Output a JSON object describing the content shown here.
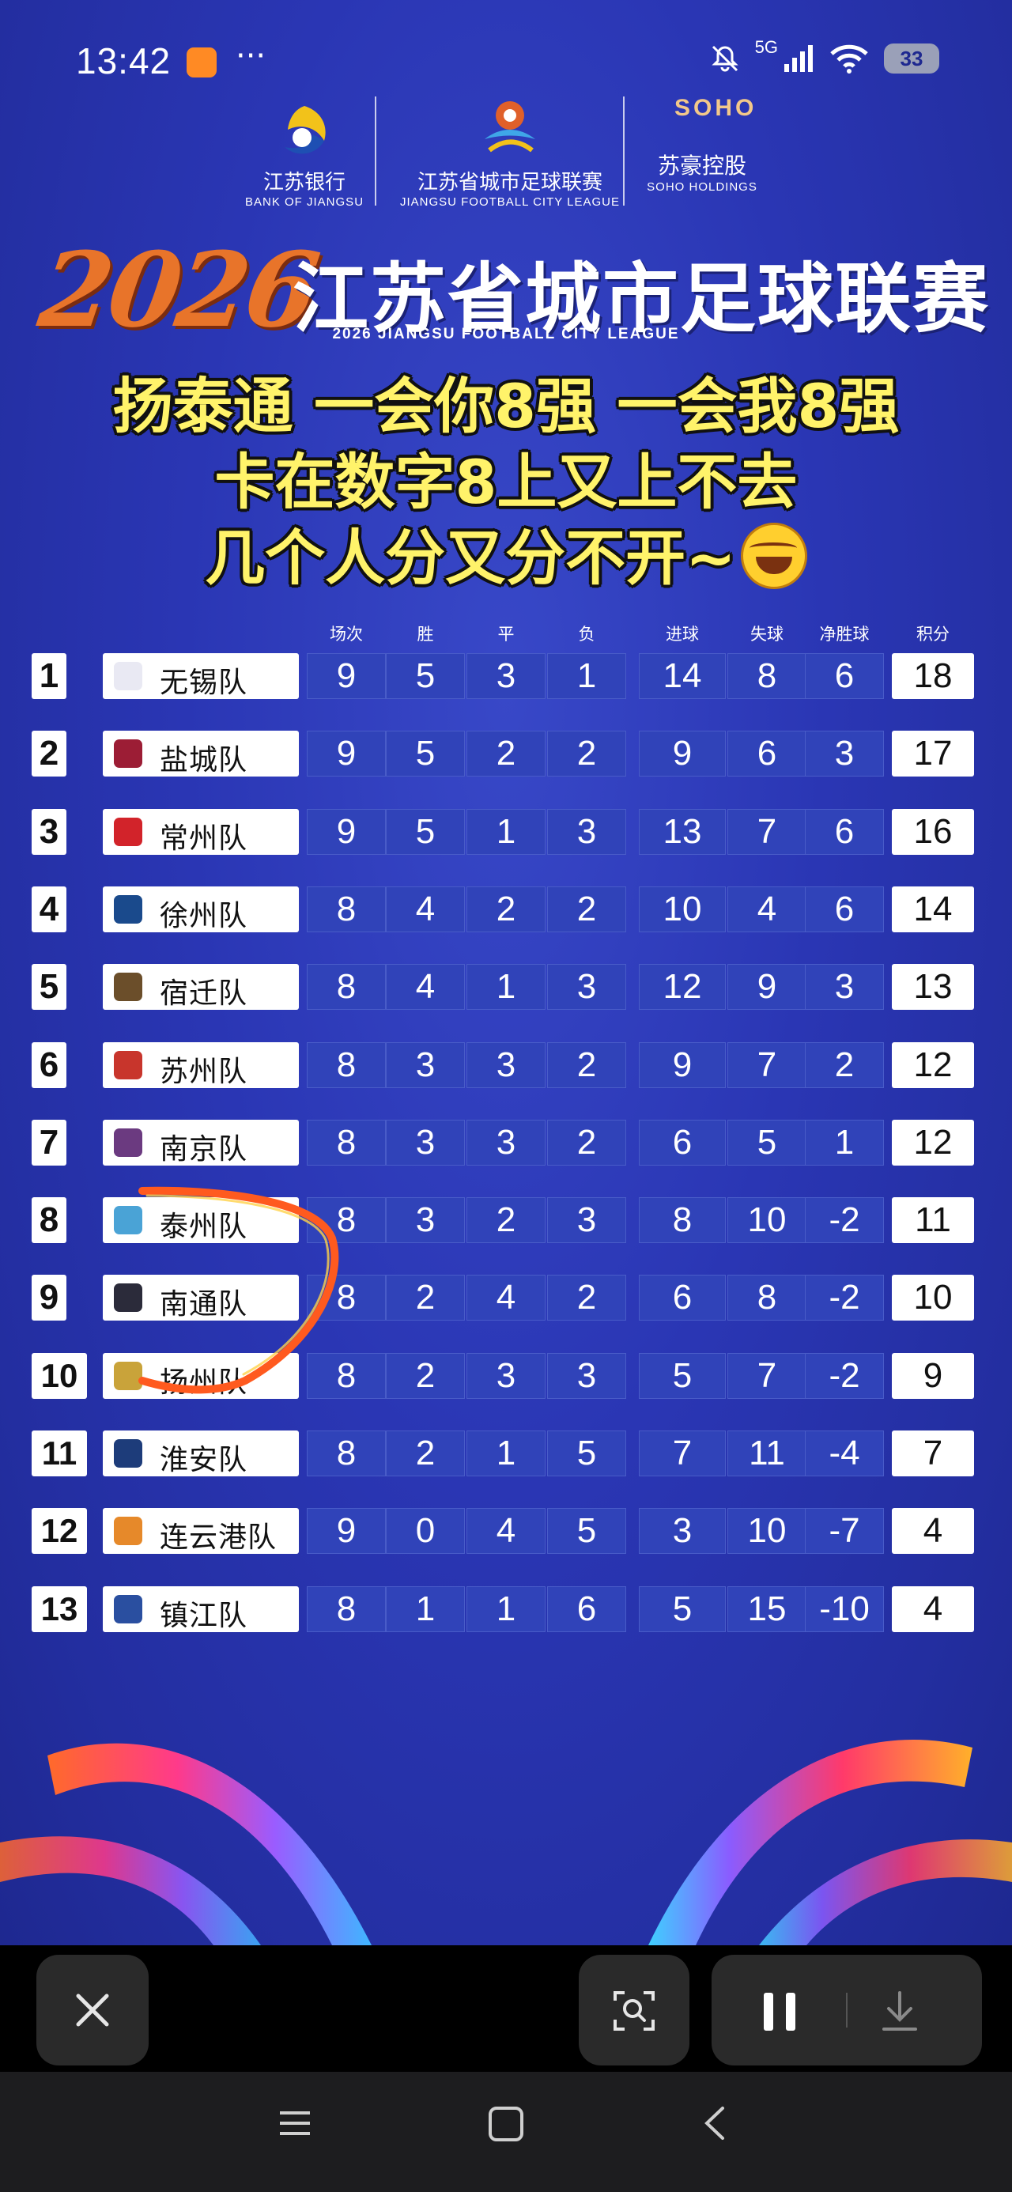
{
  "status_bar": {
    "time": "13:42",
    "network": "5G",
    "battery": "33"
  },
  "sponsors": [
    {
      "cn": "江苏银行",
      "en": "BANK OF JIANGSU"
    },
    {
      "cn": "江苏省城市足球联赛",
      "en": "JIANGSU FOOTBALL CITY LEAGUE"
    },
    {
      "logo_text": "SOHO",
      "cn": "苏豪控股",
      "en": "SOHO HOLDINGS"
    }
  ],
  "poster": {
    "year": "2026",
    "title": "江苏省城市足球联赛",
    "subtitle_en": "2026  JIANGSU FOOTBALL CITY LEAGUE",
    "caption_lines": [
      "扬泰通 一会你8强 一会我8强",
      "卡在数字8上又上不去",
      "几个人分又分不开~"
    ]
  },
  "table": {
    "columns": [
      "场次",
      "胜",
      "平",
      "负",
      "进球",
      "失球",
      "净胜球",
      "积分"
    ],
    "rows": [
      {
        "rank": "1",
        "team": "无锡队",
        "crest": "#e9e9f3",
        "played": "9",
        "w": "5",
        "d": "3",
        "l": "1",
        "gf": "14",
        "ga": "8",
        "gd": "6",
        "pts": "18"
      },
      {
        "rank": "2",
        "team": "盐城队",
        "crest": "#9c1d35",
        "played": "9",
        "w": "5",
        "d": "2",
        "l": "2",
        "gf": "9",
        "ga": "6",
        "gd": "3",
        "pts": "17"
      },
      {
        "rank": "3",
        "team": "常州队",
        "crest": "#d2232a",
        "played": "9",
        "w": "5",
        "d": "1",
        "l": "3",
        "gf": "13",
        "ga": "7",
        "gd": "6",
        "pts": "16"
      },
      {
        "rank": "4",
        "team": "徐州队",
        "crest": "#1a4a8c",
        "played": "8",
        "w": "4",
        "d": "2",
        "l": "2",
        "gf": "10",
        "ga": "4",
        "gd": "6",
        "pts": "14"
      },
      {
        "rank": "5",
        "team": "宿迁队",
        "crest": "#6b4e2a",
        "played": "8",
        "w": "4",
        "d": "1",
        "l": "3",
        "gf": "12",
        "ga": "9",
        "gd": "3",
        "pts": "13"
      },
      {
        "rank": "6",
        "team": "苏州队",
        "crest": "#c8352c",
        "played": "8",
        "w": "3",
        "d": "3",
        "l": "2",
        "gf": "9",
        "ga": "7",
        "gd": "2",
        "pts": "12"
      },
      {
        "rank": "7",
        "team": "南京队",
        "crest": "#6b3a80",
        "played": "8",
        "w": "3",
        "d": "3",
        "l": "2",
        "gf": "6",
        "ga": "5",
        "gd": "1",
        "pts": "12"
      },
      {
        "rank": "8",
        "team": "泰州队",
        "crest": "#4aa3d6",
        "played": "8",
        "w": "3",
        "d": "2",
        "l": "3",
        "gf": "8",
        "ga": "10",
        "gd": "-2",
        "pts": "11"
      },
      {
        "rank": "9",
        "team": "南通队",
        "crest": "#2b2b3a",
        "played": "8",
        "w": "2",
        "d": "4",
        "l": "2",
        "gf": "6",
        "ga": "8",
        "gd": "-2",
        "pts": "10"
      },
      {
        "rank": "10",
        "team": "扬州队",
        "crest": "#c9a33a",
        "played": "8",
        "w": "2",
        "d": "3",
        "l": "3",
        "gf": "5",
        "ga": "7",
        "gd": "-2",
        "pts": "9"
      },
      {
        "rank": "11",
        "team": "淮安队",
        "crest": "#1d3c7a",
        "played": "8",
        "w": "2",
        "d": "1",
        "l": "5",
        "gf": "7",
        "ga": "11",
        "gd": "-4",
        "pts": "7"
      },
      {
        "rank": "12",
        "team": "连云港队",
        "crest": "#e6892a",
        "played": "9",
        "w": "0",
        "d": "4",
        "l": "5",
        "gf": "3",
        "ga": "10",
        "gd": "-7",
        "pts": "4"
      },
      {
        "rank": "13",
        "team": "镇江队",
        "crest": "#2a4fa0",
        "played": "8",
        "w": "1",
        "d": "1",
        "l": "6",
        "gf": "5",
        "ga": "15",
        "gd": "-10",
        "pts": "4"
      }
    ]
  },
  "colors": {
    "poster_bg": "#2a36b4",
    "cell_bg": "#3043b9",
    "caption_yellow": "#fff36a",
    "year_orange": "#e8742a",
    "annotation": "#ff5a1f"
  },
  "toolbar": {
    "close": "close-icon",
    "scan": "scan-icon",
    "pause": "pause-icon",
    "download": "download-icon"
  }
}
